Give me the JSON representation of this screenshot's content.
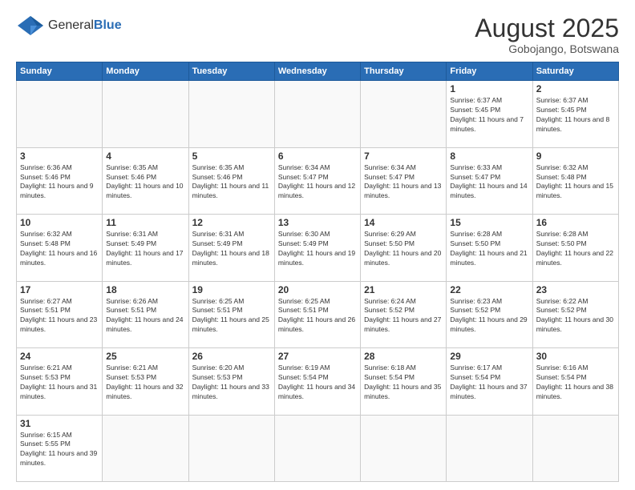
{
  "header": {
    "logo_general": "General",
    "logo_blue": "Blue",
    "month_year": "August 2025",
    "location": "Gobojango, Botswana"
  },
  "weekdays": [
    "Sunday",
    "Monday",
    "Tuesday",
    "Wednesday",
    "Thursday",
    "Friday",
    "Saturday"
  ],
  "weeks": [
    [
      {
        "day": "",
        "info": ""
      },
      {
        "day": "",
        "info": ""
      },
      {
        "day": "",
        "info": ""
      },
      {
        "day": "",
        "info": ""
      },
      {
        "day": "",
        "info": ""
      },
      {
        "day": "1",
        "info": "Sunrise: 6:37 AM\nSunset: 5:45 PM\nDaylight: 11 hours and 7 minutes."
      },
      {
        "day": "2",
        "info": "Sunrise: 6:37 AM\nSunset: 5:45 PM\nDaylight: 11 hours and 8 minutes."
      }
    ],
    [
      {
        "day": "3",
        "info": "Sunrise: 6:36 AM\nSunset: 5:46 PM\nDaylight: 11 hours and 9 minutes."
      },
      {
        "day": "4",
        "info": "Sunrise: 6:35 AM\nSunset: 5:46 PM\nDaylight: 11 hours and 10 minutes."
      },
      {
        "day": "5",
        "info": "Sunrise: 6:35 AM\nSunset: 5:46 PM\nDaylight: 11 hours and 11 minutes."
      },
      {
        "day": "6",
        "info": "Sunrise: 6:34 AM\nSunset: 5:47 PM\nDaylight: 11 hours and 12 minutes."
      },
      {
        "day": "7",
        "info": "Sunrise: 6:34 AM\nSunset: 5:47 PM\nDaylight: 11 hours and 13 minutes."
      },
      {
        "day": "8",
        "info": "Sunrise: 6:33 AM\nSunset: 5:47 PM\nDaylight: 11 hours and 14 minutes."
      },
      {
        "day": "9",
        "info": "Sunrise: 6:32 AM\nSunset: 5:48 PM\nDaylight: 11 hours and 15 minutes."
      }
    ],
    [
      {
        "day": "10",
        "info": "Sunrise: 6:32 AM\nSunset: 5:48 PM\nDaylight: 11 hours and 16 minutes."
      },
      {
        "day": "11",
        "info": "Sunrise: 6:31 AM\nSunset: 5:49 PM\nDaylight: 11 hours and 17 minutes."
      },
      {
        "day": "12",
        "info": "Sunrise: 6:31 AM\nSunset: 5:49 PM\nDaylight: 11 hours and 18 minutes."
      },
      {
        "day": "13",
        "info": "Sunrise: 6:30 AM\nSunset: 5:49 PM\nDaylight: 11 hours and 19 minutes."
      },
      {
        "day": "14",
        "info": "Sunrise: 6:29 AM\nSunset: 5:50 PM\nDaylight: 11 hours and 20 minutes."
      },
      {
        "day": "15",
        "info": "Sunrise: 6:28 AM\nSunset: 5:50 PM\nDaylight: 11 hours and 21 minutes."
      },
      {
        "day": "16",
        "info": "Sunrise: 6:28 AM\nSunset: 5:50 PM\nDaylight: 11 hours and 22 minutes."
      }
    ],
    [
      {
        "day": "17",
        "info": "Sunrise: 6:27 AM\nSunset: 5:51 PM\nDaylight: 11 hours and 23 minutes."
      },
      {
        "day": "18",
        "info": "Sunrise: 6:26 AM\nSunset: 5:51 PM\nDaylight: 11 hours and 24 minutes."
      },
      {
        "day": "19",
        "info": "Sunrise: 6:25 AM\nSunset: 5:51 PM\nDaylight: 11 hours and 25 minutes."
      },
      {
        "day": "20",
        "info": "Sunrise: 6:25 AM\nSunset: 5:51 PM\nDaylight: 11 hours and 26 minutes."
      },
      {
        "day": "21",
        "info": "Sunrise: 6:24 AM\nSunset: 5:52 PM\nDaylight: 11 hours and 27 minutes."
      },
      {
        "day": "22",
        "info": "Sunrise: 6:23 AM\nSunset: 5:52 PM\nDaylight: 11 hours and 29 minutes."
      },
      {
        "day": "23",
        "info": "Sunrise: 6:22 AM\nSunset: 5:52 PM\nDaylight: 11 hours and 30 minutes."
      }
    ],
    [
      {
        "day": "24",
        "info": "Sunrise: 6:21 AM\nSunset: 5:53 PM\nDaylight: 11 hours and 31 minutes."
      },
      {
        "day": "25",
        "info": "Sunrise: 6:21 AM\nSunset: 5:53 PM\nDaylight: 11 hours and 32 minutes."
      },
      {
        "day": "26",
        "info": "Sunrise: 6:20 AM\nSunset: 5:53 PM\nDaylight: 11 hours and 33 minutes."
      },
      {
        "day": "27",
        "info": "Sunrise: 6:19 AM\nSunset: 5:54 PM\nDaylight: 11 hours and 34 minutes."
      },
      {
        "day": "28",
        "info": "Sunrise: 6:18 AM\nSunset: 5:54 PM\nDaylight: 11 hours and 35 minutes."
      },
      {
        "day": "29",
        "info": "Sunrise: 6:17 AM\nSunset: 5:54 PM\nDaylight: 11 hours and 37 minutes."
      },
      {
        "day": "30",
        "info": "Sunrise: 6:16 AM\nSunset: 5:54 PM\nDaylight: 11 hours and 38 minutes."
      }
    ],
    [
      {
        "day": "31",
        "info": "Sunrise: 6:15 AM\nSunset: 5:55 PM\nDaylight: 11 hours and 39 minutes."
      },
      {
        "day": "",
        "info": ""
      },
      {
        "day": "",
        "info": ""
      },
      {
        "day": "",
        "info": ""
      },
      {
        "day": "",
        "info": ""
      },
      {
        "day": "",
        "info": ""
      },
      {
        "day": "",
        "info": ""
      }
    ]
  ]
}
